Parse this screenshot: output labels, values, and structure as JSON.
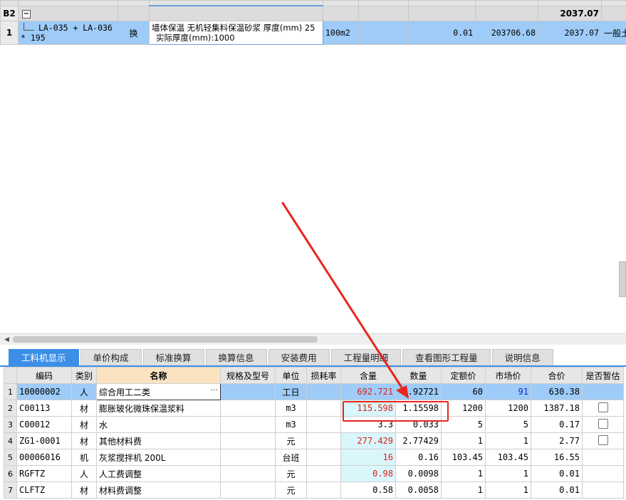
{
  "upper": {
    "group_row": {
      "code": "B2",
      "total": "2037.07"
    },
    "item_row": {
      "index": "1",
      "code": "LA-035 + LA-036 * 195",
      "type": "换",
      "name_line1": "墙体保温 无机轻集料保温砂浆 厚度(mm) 25",
      "name_line2": "实际厚度(mm):1000",
      "unit": "100m2",
      "quantity": "0.01",
      "unit_price": "203706.68",
      "total": "2037.07",
      "category": "一般土"
    }
  },
  "tabs": [
    "工料机显示",
    "单价构成",
    "标准换算",
    "换算信息",
    "安装费用",
    "工程量明细",
    "查看图形工程量",
    "说明信息"
  ],
  "table": {
    "headers": [
      "编码",
      "类别",
      "名称",
      "规格及型号",
      "单位",
      "损耗率",
      "含量",
      "数量",
      "定额价",
      "市场价",
      "合价",
      "是否暂估"
    ],
    "rows": [
      {
        "no": "1",
        "code": "10000002",
        "cat": "人",
        "name": "综合用工二类",
        "spec": "",
        "unit": "工日",
        "loss": "",
        "content": "692.721",
        "qty": "6.92721",
        "quota": "60",
        "market": "91",
        "amount": "630.38"
      },
      {
        "no": "2",
        "code": "C00113",
        "cat": "材",
        "name": "膨胀玻化微珠保温浆料",
        "spec": "",
        "unit": "m3",
        "loss": "",
        "content": "115.598",
        "qty": "1.15598",
        "quota": "1200",
        "market": "1200",
        "amount": "1387.18"
      },
      {
        "no": "3",
        "code": "C00012",
        "cat": "材",
        "name": "水",
        "spec": "",
        "unit": "m3",
        "loss": "",
        "content": "3.3",
        "qty": "0.033",
        "quota": "5",
        "market": "5",
        "amount": "0.17"
      },
      {
        "no": "4",
        "code": "ZG1-0001",
        "cat": "材",
        "name": "其他材料费",
        "spec": "",
        "unit": "元",
        "loss": "",
        "content": "277.429",
        "qty": "2.77429",
        "quota": "1",
        "market": "1",
        "amount": "2.77"
      },
      {
        "no": "5",
        "code": "00006016",
        "cat": "机",
        "name": "灰浆搅拌机 200L",
        "spec": "",
        "unit": "台班",
        "loss": "",
        "content": "16",
        "qty": "0.16",
        "quota": "103.45",
        "market": "103.45",
        "amount": "16.55"
      },
      {
        "no": "6",
        "code": "RGFTZ",
        "cat": "人",
        "name": "人工费调整",
        "spec": "",
        "unit": "元",
        "loss": "",
        "content": "0.98",
        "qty": "0.0098",
        "quota": "1",
        "market": "1",
        "amount": "0.01"
      },
      {
        "no": "7",
        "code": "CLFTZ",
        "cat": "材",
        "name": "材料费调整",
        "spec": "",
        "unit": "元",
        "loss": "",
        "content": "0.58",
        "qty": "0.0058",
        "quota": "1",
        "market": "1",
        "amount": "0.01"
      }
    ]
  },
  "icons": {
    "expand": "minus-box-icon",
    "ellipsis": "ellipsis-icon",
    "checkbox": "checkbox-icon"
  },
  "colors": {
    "selection": "#9ecbf7",
    "tab_active": "#3c8fe6",
    "annotation": "#e8261e",
    "red_text": "#e0201a",
    "blue_text": "#1428c8"
  }
}
